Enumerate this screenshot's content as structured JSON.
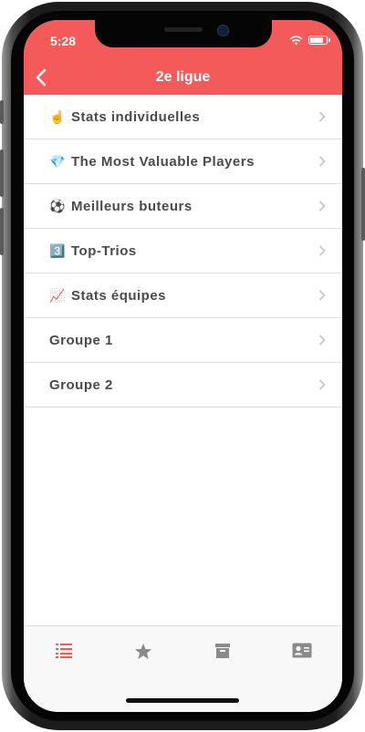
{
  "status": {
    "time": "5:28"
  },
  "nav": {
    "title": "2e ligue",
    "back_icon": "chevron-left-icon"
  },
  "menu": [
    {
      "emoji": "☝️",
      "label": "Stats individuelles"
    },
    {
      "emoji": "💎",
      "label": "The Most Valuable Players"
    },
    {
      "emoji": "⚽",
      "label": "Meilleurs buteurs"
    },
    {
      "emoji": "3️⃣",
      "label": "Top-Trios"
    },
    {
      "emoji": "📈",
      "label": "Stats équipes"
    },
    {
      "emoji": "",
      "label": "Groupe 1"
    },
    {
      "emoji": "",
      "label": "Groupe 2"
    }
  ],
  "tabs": [
    {
      "icon": "list-icon",
      "active": true
    },
    {
      "icon": "star-icon",
      "active": false
    },
    {
      "icon": "archive-icon",
      "active": false
    },
    {
      "icon": "contact-card-icon",
      "active": false
    }
  ],
  "colors": {
    "accent": "#f45a5a",
    "tab_inactive": "#8a8a8a"
  }
}
